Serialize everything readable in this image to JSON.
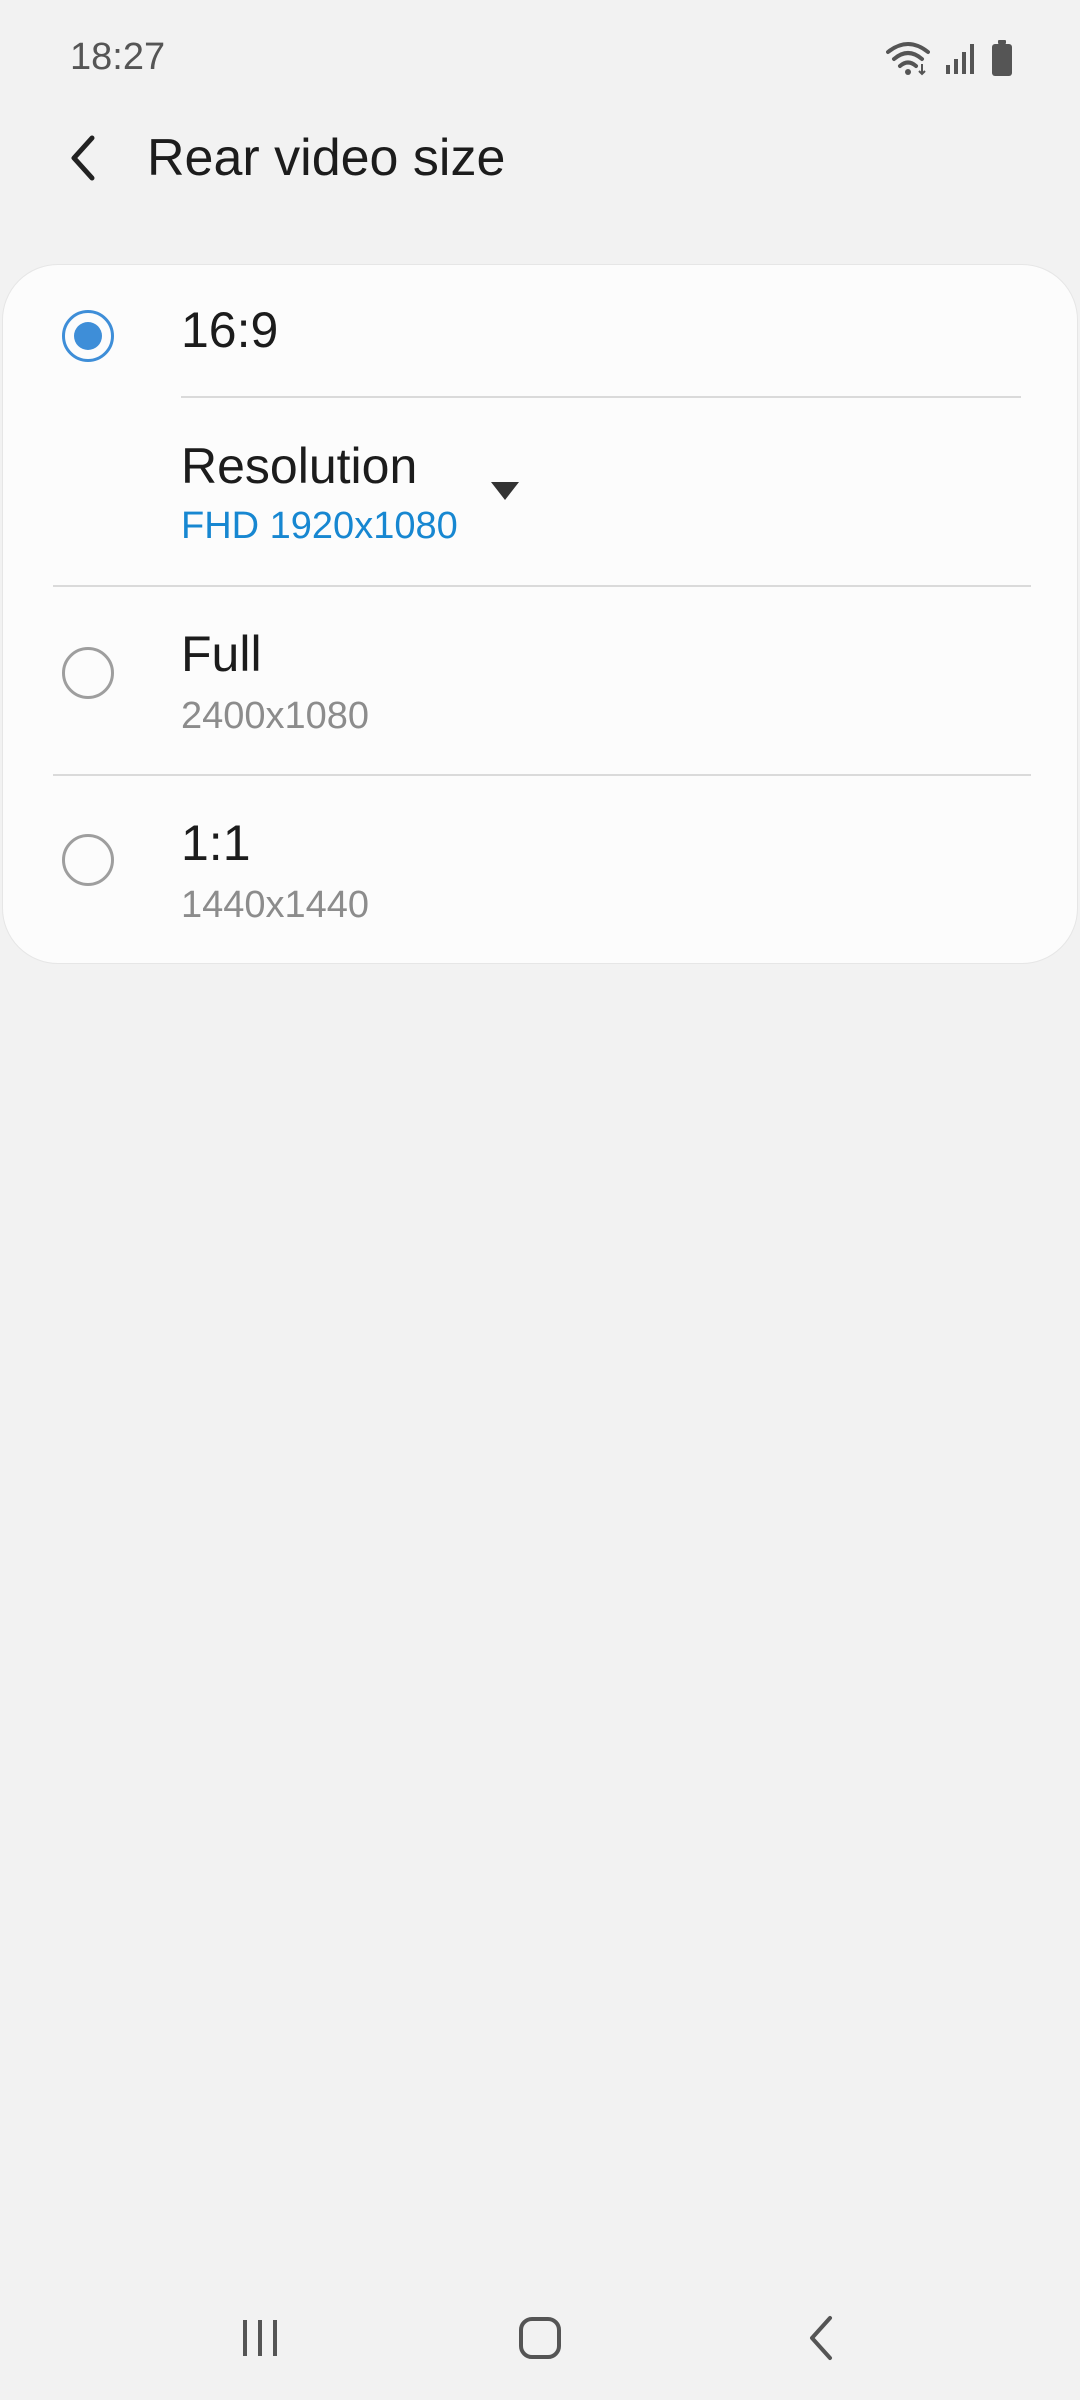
{
  "status_bar": {
    "time": "18:27",
    "icons": [
      "wifi-icon",
      "signal-icon",
      "battery-icon"
    ]
  },
  "header": {
    "back_icon": "back-arrow-icon",
    "title": "Rear video size"
  },
  "options": [
    {
      "title": "16:9",
      "subtitle": "",
      "selected": true
    },
    {
      "title": "Full",
      "subtitle": "2400x1080",
      "selected": false
    },
    {
      "title": "1:1",
      "subtitle": "1440x1440",
      "selected": false
    }
  ],
  "resolution": {
    "label": "Resolution",
    "value": "FHD 1920x1080",
    "dropdown_icon": "dropdown-triangle-icon"
  },
  "navigation": {
    "recents_icon": "recents-icon",
    "home_icon": "home-icon",
    "back_icon": "nav-back-icon"
  },
  "colors": {
    "accent": "#3e8ed8",
    "link": "#1787d1",
    "background": "#f2f2f2",
    "card": "#fcfcfc"
  }
}
